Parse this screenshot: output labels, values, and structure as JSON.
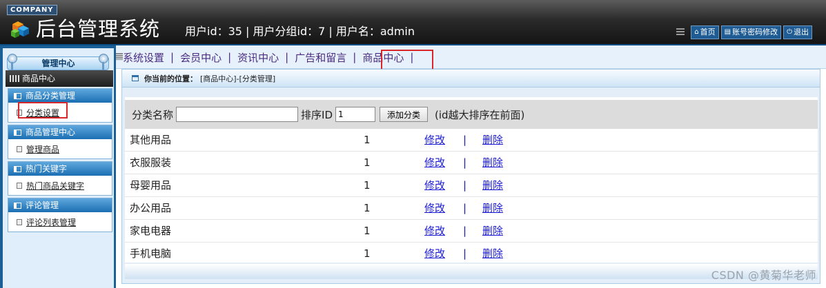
{
  "header": {
    "company": "COMPANY",
    "title": "后台管理系统",
    "user_info": "用户id：35 | 用户分组id：7 | 用户名：admin",
    "links": [
      {
        "icon": "home-icon",
        "label": "首页"
      },
      {
        "icon": "account-icon",
        "label": "账号密码修改"
      },
      {
        "icon": "power-icon",
        "label": "退出"
      }
    ]
  },
  "sidebar": {
    "center_title": "管理中心",
    "section_label": "商品中心",
    "groups": [
      {
        "title": "商品分类管理",
        "item": "分类设置"
      },
      {
        "title": "商品管理中心",
        "item": "管理商品"
      },
      {
        "title": "热门关键字",
        "item": "热门商品关键字"
      },
      {
        "title": "评论管理",
        "item": "评论列表管理"
      }
    ]
  },
  "topnav": {
    "items": [
      "系统设置",
      "会员中心",
      "资讯中心",
      "广告和留言",
      "商品中心"
    ],
    "separator": "|"
  },
  "location": {
    "label": "你当前的位置：",
    "path": "[商品中心]-[分类管理]"
  },
  "form": {
    "name_label": "分类名称",
    "name_value": "",
    "order_label": "排序ID",
    "order_value": "1",
    "button": "添加分类",
    "hint": "(id越大排序在前面)"
  },
  "table": {
    "edit_label": "修改",
    "delete_label": "删除",
    "divider": "|",
    "rows": [
      {
        "name": "其他用品",
        "order": "1"
      },
      {
        "name": "衣服服装",
        "order": "1"
      },
      {
        "name": "母婴用品",
        "order": "1"
      },
      {
        "name": "办公用品",
        "order": "1"
      },
      {
        "name": "家电电器",
        "order": "1"
      },
      {
        "name": "手机电脑",
        "order": "1"
      }
    ]
  },
  "watermark": "CSDN @黄菊华老师"
}
